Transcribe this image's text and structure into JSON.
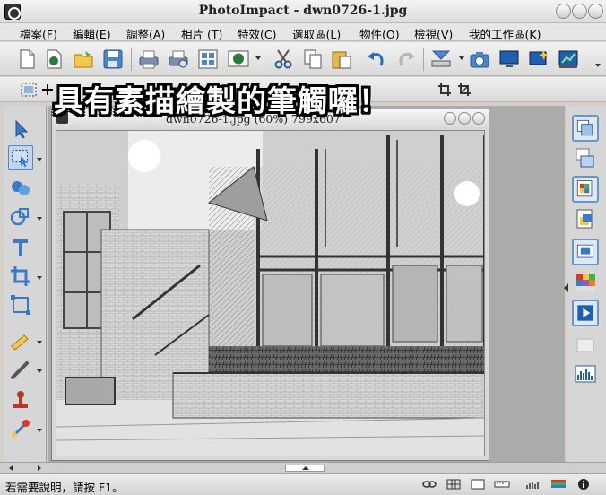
{
  "window": {
    "title": "PhotoImpact - dwn0726-1.jpg"
  },
  "menu": [
    {
      "label": "檔案(F)"
    },
    {
      "label": "編輯(E)"
    },
    {
      "label": "調整(A)"
    },
    {
      "label": "相片 (T)"
    },
    {
      "label": "特效(C)"
    },
    {
      "label": "選取區(L)"
    },
    {
      "label": "物件(O)"
    },
    {
      "label": "檢視(V)"
    },
    {
      "label": "我的工作區(K)"
    }
  ],
  "toolbar": {
    "icons": [
      "new-icon",
      "open-web-icon",
      "open-folder-icon",
      "save-icon",
      "print-icon",
      "print-preview-icon",
      "thumbnail-icon",
      "web-icon",
      "cut-icon",
      "copy-icon",
      "paste-icon",
      "undo-icon",
      "redo-icon",
      "scanner-icon",
      "camera-icon",
      "display-icon",
      "magic-icon",
      "chart-icon"
    ]
  },
  "overlay_caption": "具有素描繪製的筆觸囉！",
  "document": {
    "title": "dwn0726-1.jpg (60%) 799x607"
  },
  "statusbar": {
    "help": "若需要說明，請按 F1。"
  },
  "colors": {
    "accent": "#6d94c4",
    "chrome": "#d4d0c8",
    "workspace": "#a9aca8"
  }
}
